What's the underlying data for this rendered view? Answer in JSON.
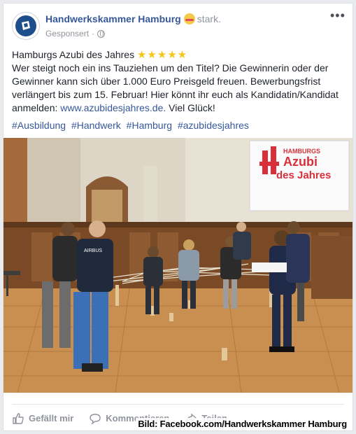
{
  "post": {
    "page_name": "Handwerkskammer Hamburg",
    "feeling": "stark.",
    "sponsored": "Gesponsert",
    "more_label": "•••",
    "title": "Hamburgs Azubi des Jahres",
    "stars": "★★★★★",
    "body_before_link": "Wer steigt noch ein ins Tauziehen um den Titel? Die Gewinnerin oder der Gewinner kann sich über 1.000 Euro Preisgeld freuen. Bewerbungsfrist verlängert bis zum 15. Februar! Hier könnt ihr euch als Kandidatin/Kandidat anmelden: ",
    "link": "www.azubidesjahres.de.",
    "body_after_link": " Viel Glück!",
    "hashtags": [
      "#Ausbildung",
      "#Handwerk",
      "#Hamburg",
      "#azubidesjahres"
    ]
  },
  "photo": {
    "screen_line1": "HAMBURGS",
    "screen_line2": "Azubi",
    "screen_line3": "des Jahres",
    "shirt_text": "AIRBUS"
  },
  "actions": {
    "like": "Gefällt mir",
    "comment": "Kommentieren",
    "share": "Teilen"
  },
  "credit": "Bild: Facebook.com/Handwerkskammer Hamburg",
  "colors": {
    "link": "#365899",
    "accent_red": "#d7303b",
    "muted": "#90949c"
  },
  "icons": [
    "globe-icon",
    "more-options-icon",
    "like-icon",
    "comment-icon",
    "share-icon"
  ]
}
